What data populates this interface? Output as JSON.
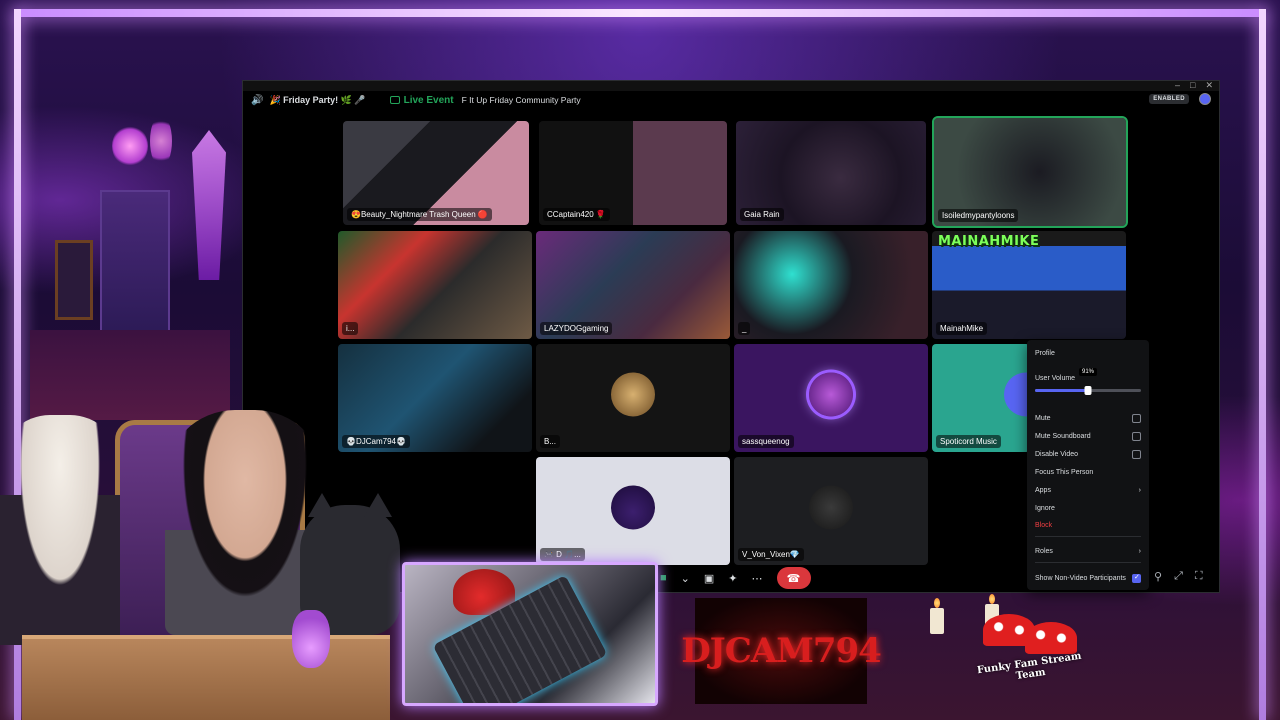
{
  "discord": {
    "event_icon": "speaker-icon",
    "event_name": "🎉 Friday Party! 🌿 🎤",
    "live_label": "Live Event",
    "event_title": "F It Up Friday Community Party",
    "enabled_badge": "ENABLED",
    "window_controls": [
      "–",
      "□",
      "✕"
    ]
  },
  "participants": [
    {
      "name": "😍Beauty_Nightmare Trash Queen 🔴",
      "video": true
    },
    {
      "name": "CCaptain420 🌹",
      "video": true
    },
    {
      "name": "Gaia Rain",
      "video": true
    },
    {
      "name": "Isoiledmypantyloons",
      "video": true,
      "speaking": true
    },
    {
      "name": "i...",
      "video": true
    },
    {
      "name": "LAZYDOGgaming",
      "video": true
    },
    {
      "name": "",
      "video": true
    },
    {
      "name": "_",
      "video": true
    },
    {
      "name": "MainahMike",
      "video": true,
      "banner": "MAINAHMIKE"
    },
    {
      "name": "💀DJCam794💀",
      "video": true
    },
    {
      "name": "B...",
      "video": false
    },
    {
      "name": "sassqueenog",
      "video": false
    },
    {
      "name": "Spoticord Music",
      "video": false
    },
    {
      "name": "🎮 D 🎵...",
      "video": false
    },
    {
      "name": "V_Von_Vixen💎",
      "video": false
    }
  ],
  "context_menu": {
    "profile": "Profile",
    "user_volume": "User Volume",
    "volume_value": "91%",
    "volume_fraction": 0.5,
    "mute": "Mute",
    "mute_soundboard": "Mute Soundboard",
    "disable_video": "Disable Video",
    "focus": "Focus This Person",
    "apps": "Apps",
    "ignore": "Ignore",
    "block": "Block",
    "roles": "Roles",
    "show_non_video": "Show Non-Video Participants",
    "show_non_video_checked": true
  },
  "overlay": {
    "banner_text": "DJCAM794",
    "team_text": "Funky Fam Stream Team"
  },
  "colors": {
    "speaking": "#23a55a",
    "hangup": "#da373c",
    "accent": "#5865f2",
    "danger": "#f23f43"
  }
}
